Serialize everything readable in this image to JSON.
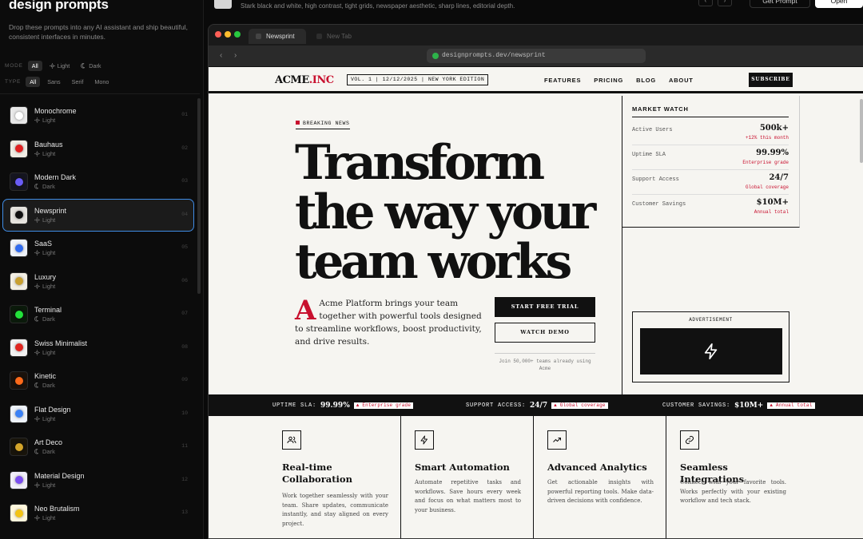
{
  "sidebar": {
    "title": "design prompts",
    "tagline": "Drop these prompts into any AI assistant and ship beautiful, consistent interfaces in minutes.",
    "mode_label": "MODE",
    "mode_options": [
      "All",
      "Light",
      "Dark"
    ],
    "type_label": "TYPE",
    "type_options": [
      "All",
      "Sans",
      "Serif",
      "Mono"
    ],
    "items": [
      {
        "name": "Monochrome",
        "mode": "Light",
        "num": "01",
        "color": "#ffffff",
        "bg": "#e8e8e8"
      },
      {
        "name": "Bauhaus",
        "mode": "Light",
        "num": "02",
        "color": "#e02020",
        "bg": "#f0ece4"
      },
      {
        "name": "Modern Dark",
        "mode": "Dark",
        "num": "03",
        "color": "#6a5cf6",
        "bg": "#15151f"
      },
      {
        "name": "Newsprint",
        "mode": "Light",
        "num": "04",
        "color": "#111111",
        "bg": "#e6e4df"
      },
      {
        "name": "SaaS",
        "mode": "Light",
        "num": "05",
        "color": "#2f6bf0",
        "bg": "#eef2fa"
      },
      {
        "name": "Luxury",
        "mode": "Light",
        "num": "06",
        "color": "#c9a030",
        "bg": "#f3efe4"
      },
      {
        "name": "Terminal",
        "mode": "Dark",
        "num": "07",
        "color": "#22e33a",
        "bg": "#0b1a0b"
      },
      {
        "name": "Swiss Minimalist",
        "mode": "Light",
        "num": "08",
        "color": "#e0251f",
        "bg": "#f2f2f2"
      },
      {
        "name": "Kinetic",
        "mode": "Dark",
        "num": "09",
        "color": "#ff6a1a",
        "bg": "#1a120c"
      },
      {
        "name": "Flat Design",
        "mode": "Light",
        "num": "10",
        "color": "#3b82f6",
        "bg": "#eef3fb"
      },
      {
        "name": "Art Deco",
        "mode": "Dark",
        "num": "11",
        "color": "#d4a52a",
        "bg": "#18140b"
      },
      {
        "name": "Material Design",
        "mode": "Light",
        "num": "12",
        "color": "#7b4df0",
        "bg": "#f1eefa"
      },
      {
        "name": "Neo Brutalism",
        "mode": "Light",
        "num": "13",
        "color": "#f3c315",
        "bg": "#fff7dc"
      }
    ]
  },
  "topbar": {
    "description": "Stark black and white, high contrast, tight grids, newspaper aesthetic, sharp lines, editorial depth.",
    "prev_icon": "chevron-left-icon",
    "next_icon": "chevron-right-icon",
    "get_prompt_label": "Get Prompt",
    "open_label": "Open"
  },
  "browser": {
    "active_tab": "Newsprint",
    "inactive_tab": "New Tab",
    "url": "designprompts.dev/newsprint"
  },
  "newsprint": {
    "logo_main": "ACME",
    "logo_accent": ".INC",
    "edition": "VOL. 1 | 12/12/2025 | NEW YORK EDITION",
    "nav": [
      "FEATURES",
      "PRICING",
      "BLOG",
      "ABOUT"
    ],
    "subscribe": "SUBSCRIBE",
    "breaking": "BREAKING NEWS",
    "headline_lines": [
      "Transform",
      "the way your",
      "team works"
    ],
    "dropcap": "A",
    "lede": "Acme Platform brings your team together with powerful tools designed to streamline workflows, boost productivity, and drive results.",
    "cta_primary": "START FREE TRIAL",
    "cta_secondary": "WATCH DEMO",
    "social_proof": "Join 50,000+ teams already using Acme",
    "market_title": "MARKET WATCH",
    "market": [
      {
        "label": "Active Users",
        "value": "500k+",
        "sub": "+12% this month"
      },
      {
        "label": "Uptime SLA",
        "value": "99.99%",
        "sub": "Enterprise grade"
      },
      {
        "label": "Support Access",
        "value": "24/7",
        "sub": "Global coverage"
      },
      {
        "label": "Customer Savings",
        "value": "$10M+",
        "sub": "Annual total"
      }
    ],
    "ad_label": "ADVERTISEMENT",
    "ad_icon": "lightning-icon",
    "ticker": [
      {
        "label": "UPTIME SLA:",
        "value": "99.99%",
        "badge": "▲ Enterprise grade"
      },
      {
        "label": "SUPPORT ACCESS:",
        "value": "24/7",
        "badge": "▲ Global coverage"
      },
      {
        "label": "CUSTOMER SAVINGS:",
        "value": "$10M+",
        "badge": "▲ Annual total"
      }
    ],
    "features": [
      {
        "title": "Real-time Collaboration",
        "desc": "Work together seamlessly with your team. Share updates, communicate instantly, and stay aligned on every project.",
        "icon": "users-icon"
      },
      {
        "title": "Smart Automation",
        "desc": "Automate repetitive tasks and workflows. Save hours every week and focus on what matters most to your business.",
        "icon": "lightning-icon"
      },
      {
        "title": "Advanced Analytics",
        "desc": "Get actionable insights with powerful reporting tools. Make data-driven decisions with confidence.",
        "icon": "trending-up-icon"
      },
      {
        "title": "Seamless Integrations",
        "desc": "Connect with your favorite tools. Works perfectly with your existing workflow and tech stack.",
        "icon": "link-icon"
      }
    ]
  }
}
